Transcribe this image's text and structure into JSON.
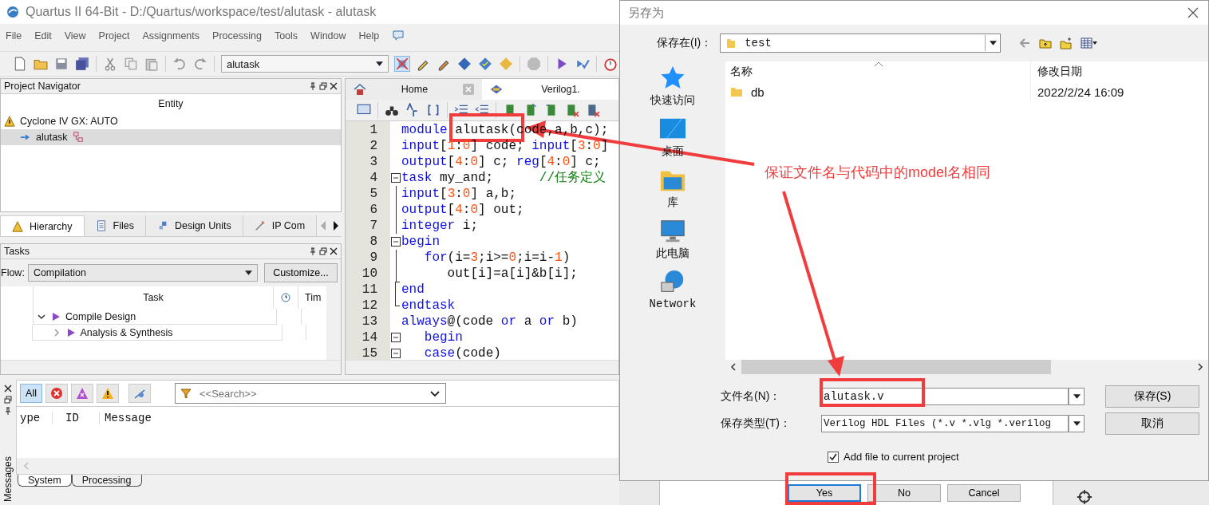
{
  "window": {
    "title": "Quartus II 64-Bit - D:/Quartus/workspace/test/alutask - alutask"
  },
  "menu": [
    "File",
    "Edit",
    "View",
    "Project",
    "Assignments",
    "Processing",
    "Tools",
    "Window",
    "Help"
  ],
  "toolbar": {
    "project_combo": "alutask"
  },
  "project_navigator": {
    "title": "Project Navigator",
    "column": "Entity",
    "items": [
      {
        "label": "Cyclone IV GX: AUTO",
        "kind": "device",
        "selected": false
      },
      {
        "label": "alutask",
        "kind": "entity",
        "selected": true
      }
    ]
  },
  "nav_tabs": [
    {
      "label": "Hierarchy",
      "kind": "hierarchy",
      "selected": true
    },
    {
      "label": "Files",
      "kind": "files",
      "selected": false
    },
    {
      "label": "Design Units",
      "kind": "units",
      "selected": false
    },
    {
      "label": "IP Com",
      "kind": "ip",
      "selected": false
    }
  ],
  "tasks": {
    "title": "Tasks",
    "flow_label": "Flow:",
    "flow": "Compilation",
    "customize": "Customize...",
    "columns": [
      "Task",
      "Tim"
    ],
    "rows": [
      {
        "label": "Compile Design",
        "expanded": true,
        "children": [
          {
            "label": "Analysis & Synthesis",
            "expanded": false
          }
        ]
      }
    ]
  },
  "editor_tabs": [
    {
      "label": "Home",
      "kind": "home",
      "selected": false
    },
    {
      "label": "Verilog1.",
      "kind": "file",
      "selected": true
    }
  ],
  "code": [
    {
      "n": "1",
      "kind": "plain",
      "tokens": [
        {
          "t": "module ",
          "kind": "keyword"
        },
        {
          "t": "alutask",
          "kind": "text"
        },
        {
          "t": "(code,a,b,c);",
          "kind": "text"
        }
      ]
    },
    {
      "n": "2",
      "kind": "plain",
      "tokens": [
        {
          "t": "input",
          "kind": "keyword"
        },
        {
          "t": "[",
          "kind": "text"
        },
        {
          "t": "1",
          "kind": "number"
        },
        {
          "t": ":",
          "kind": "text"
        },
        {
          "t": "0",
          "kind": "number"
        },
        {
          "t": "] code; ",
          "kind": "text"
        },
        {
          "t": "input",
          "kind": "keyword"
        },
        {
          "t": "[",
          "kind": "text"
        },
        {
          "t": "3",
          "kind": "number"
        },
        {
          "t": ":",
          "kind": "text"
        },
        {
          "t": "0",
          "kind": "number"
        },
        {
          "t": "]",
          "kind": "text"
        }
      ]
    },
    {
      "n": "3",
      "kind": "plain",
      "tokens": [
        {
          "t": "output",
          "kind": "keyword"
        },
        {
          "t": "[",
          "kind": "text"
        },
        {
          "t": "4",
          "kind": "number"
        },
        {
          "t": ":",
          "kind": "text"
        },
        {
          "t": "0",
          "kind": "number"
        },
        {
          "t": "] c; ",
          "kind": "text"
        },
        {
          "t": "reg",
          "kind": "keyword"
        },
        {
          "t": "[",
          "kind": "text"
        },
        {
          "t": "4",
          "kind": "number"
        },
        {
          "t": ":",
          "kind": "text"
        },
        {
          "t": "0",
          "kind": "number"
        },
        {
          "t": "] c;",
          "kind": "text"
        }
      ]
    },
    {
      "n": "4",
      "kind": "fold-start",
      "tokens": [
        {
          "t": "task",
          "kind": "keyword"
        },
        {
          "t": " my_and;      ",
          "kind": "text"
        },
        {
          "t": "//任务定义",
          "kind": "comment"
        }
      ]
    },
    {
      "n": "5",
      "kind": "fold-body",
      "tokens": [
        {
          "t": "input",
          "kind": "keyword"
        },
        {
          "t": "[",
          "kind": "text"
        },
        {
          "t": "3",
          "kind": "number"
        },
        {
          "t": ":",
          "kind": "text"
        },
        {
          "t": "0",
          "kind": "number"
        },
        {
          "t": "] a,b;",
          "kind": "text"
        }
      ]
    },
    {
      "n": "6",
      "kind": "fold-body",
      "tokens": [
        {
          "t": "output",
          "kind": "keyword"
        },
        {
          "t": "[",
          "kind": "text"
        },
        {
          "t": "4",
          "kind": "number"
        },
        {
          "t": ":",
          "kind": "text"
        },
        {
          "t": "0",
          "kind": "number"
        },
        {
          "t": "] out;",
          "kind": "text"
        }
      ]
    },
    {
      "n": "7",
      "kind": "fold-body",
      "tokens": [
        {
          "t": "integer",
          "kind": "keyword"
        },
        {
          "t": " i;",
          "kind": "text"
        }
      ]
    },
    {
      "n": "8",
      "kind": "fold-start",
      "tokens": [
        {
          "t": "begin",
          "kind": "keyword"
        }
      ]
    },
    {
      "n": "9",
      "kind": "fold-body",
      "tokens": [
        {
          "t": "   for",
          "kind": "keyword"
        },
        {
          "t": "(i=",
          "kind": "text"
        },
        {
          "t": "3",
          "kind": "number"
        },
        {
          "t": ";i>=",
          "kind": "text"
        },
        {
          "t": "0",
          "kind": "number"
        },
        {
          "t": ";i=i-",
          "kind": "text"
        },
        {
          "t": "1",
          "kind": "number"
        },
        {
          "t": ")",
          "kind": "text"
        }
      ]
    },
    {
      "n": "10",
      "kind": "fold-body",
      "tokens": [
        {
          "t": "      out[i]=a[i]&b[i];",
          "kind": "text"
        }
      ]
    },
    {
      "n": "11",
      "kind": "fold-mid",
      "tokens": [
        {
          "t": "end",
          "kind": "keyword"
        }
      ]
    },
    {
      "n": "12",
      "kind": "fold-end",
      "tokens": [
        {
          "t": "endtask",
          "kind": "keyword"
        }
      ]
    },
    {
      "n": "13",
      "kind": "plain",
      "tokens": [
        {
          "t": "always",
          "kind": "keyword"
        },
        {
          "t": "@(code ",
          "kind": "text"
        },
        {
          "t": "or",
          "kind": "keyword"
        },
        {
          "t": " a ",
          "kind": "text"
        },
        {
          "t": "or",
          "kind": "keyword"
        },
        {
          "t": " b)",
          "kind": "text"
        }
      ]
    },
    {
      "n": "14",
      "kind": "fold-start",
      "tokens": [
        {
          "t": "   begin",
          "kind": "keyword"
        }
      ]
    },
    {
      "n": "15",
      "kind": "fold-start",
      "tokens": [
        {
          "t": "   case",
          "kind": "keyword"
        },
        {
          "t": "(code)",
          "kind": "text"
        }
      ]
    }
  ],
  "messages": {
    "side_label": "Messages",
    "filters": [
      {
        "kind": "all",
        "label": "All",
        "selected": true
      },
      {
        "kind": "error",
        "selected": false
      },
      {
        "kind": "critical",
        "selected": false
      },
      {
        "kind": "warning",
        "selected": false
      },
      {
        "kind": "suppressed",
        "selected": false
      }
    ],
    "search_placeholder": "<<Search>>",
    "columns": [
      "ype",
      "ID",
      "Message"
    ],
    "tabs": [
      {
        "label": "System",
        "selected": true
      },
      {
        "label": "Processing",
        "selected": false
      }
    ]
  },
  "save_dialog": {
    "title": "另存为",
    "location_label": "保存在(I)：",
    "location": "test",
    "places": [
      {
        "kind": "quick",
        "label": "快速访问"
      },
      {
        "kind": "desktop",
        "label": "桌面"
      },
      {
        "kind": "library",
        "label": "库"
      },
      {
        "kind": "pc",
        "label": "此电脑"
      },
      {
        "kind": "network",
        "label": "Network"
      }
    ],
    "columns": [
      "名称",
      "修改日期"
    ],
    "files": [
      {
        "name": "db",
        "modified": "2022/2/24 16:09"
      }
    ],
    "filename_label": "文件名(N)：",
    "filename": "alutask.v",
    "type_label": "保存类型(T)：",
    "type": "Verilog HDL Files (*.v *.vlg *.verilog",
    "save": "保存(S)",
    "cancel": "取消",
    "add_to_project": {
      "label": "Add file to current project",
      "checked": true
    }
  },
  "confirm_buttons": [
    {
      "label": "Yes",
      "default": true
    },
    {
      "label": "No",
      "default": false
    },
    {
      "label": "Cancel",
      "default": false
    }
  ],
  "annotation": {
    "note": "保证文件名与代码中的model名相同"
  }
}
